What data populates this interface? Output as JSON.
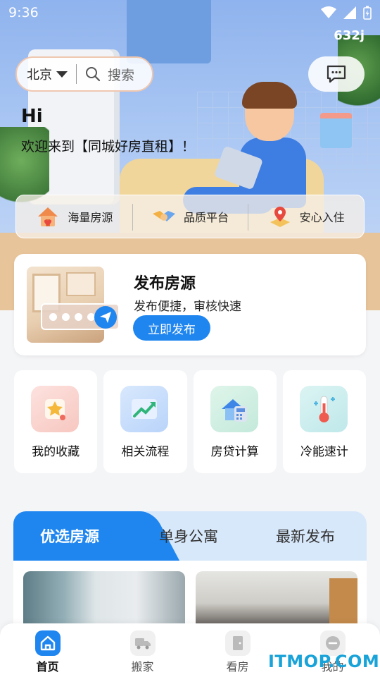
{
  "status_bar": {
    "time": "9:36",
    "extra": "632j"
  },
  "search": {
    "city": "北京",
    "placeholder": "搜索"
  },
  "greeting": {
    "hi": "Hi",
    "welcome": "欢迎来到【同城好房直租】！"
  },
  "features": [
    {
      "label": "海量房源",
      "icon": "house-icon"
    },
    {
      "label": "品质平台",
      "icon": "handshake-icon"
    },
    {
      "label": "安心入住",
      "icon": "map-pin-icon"
    }
  ],
  "publish": {
    "title": "发布房源",
    "subtitle": "发布便捷，审核快速",
    "button": "立即发布"
  },
  "grid": [
    {
      "label": "我的收藏",
      "icon": "star-icon"
    },
    {
      "label": "相关流程",
      "icon": "trend-arrow-icon"
    },
    {
      "label": "房贷计算",
      "icon": "calculator-icon"
    },
    {
      "label": "冷能速计",
      "icon": "thermometer-icon"
    }
  ],
  "tabs": [
    {
      "label": "优选房源",
      "active": true
    },
    {
      "label": "单身公寓",
      "active": false
    },
    {
      "label": "最新发布",
      "active": false
    }
  ],
  "bottom_nav": [
    {
      "label": "首页",
      "active": true,
      "icon": "home-icon"
    },
    {
      "label": "搬家",
      "active": false,
      "icon": "truck-icon"
    },
    {
      "label": "看房",
      "active": false,
      "icon": "door-icon"
    },
    {
      "label": "我的",
      "active": false,
      "icon": "profile-icon"
    }
  ],
  "watermark": "ITMOP.COM",
  "colors": {
    "accent": "#1f86f0",
    "tab_bg": "#d8e8fb"
  }
}
